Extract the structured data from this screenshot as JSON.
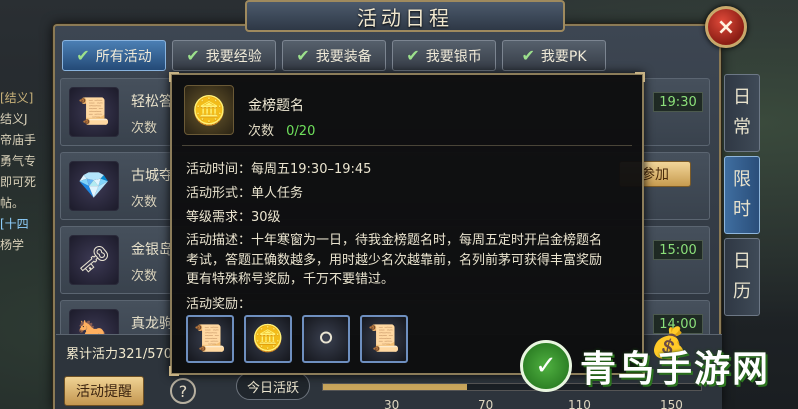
{
  "window": {
    "title": "活动日程"
  },
  "tabs": [
    {
      "label": "所有活动",
      "active": true
    },
    {
      "label": "我要经验",
      "active": false
    },
    {
      "label": "我要装备",
      "active": false
    },
    {
      "label": "我要银币",
      "active": false
    },
    {
      "label": "我要PK",
      "active": false
    }
  ],
  "side_tabs": [
    {
      "chars": [
        "日",
        "常"
      ],
      "active": false
    },
    {
      "chars": [
        "限",
        "时"
      ],
      "active": true
    },
    {
      "chars": [
        "日",
        "历"
      ],
      "active": false
    }
  ],
  "chat": {
    "lines": [
      "[结义]",
      "结义J",
      "帝庙手",
      "勇气专",
      "即可死",
      "帖。",
      "[十四",
      "杨学"
    ]
  },
  "activities": [
    {
      "name": "轻松答",
      "count_label": "次数",
      "time": "19:30",
      "icon": "scroll-icon"
    },
    {
      "name": "古城夺",
      "count_label": "次数",
      "join_label": "参加",
      "icon": "gem-icon"
    },
    {
      "name": "金银岛",
      "count_label": "次数",
      "time": "15:00",
      "icon": "key-icon"
    },
    {
      "name": "真龙驹",
      "count_label": "",
      "time": "14:00",
      "icon": "horse-icon"
    }
  ],
  "tooltip": {
    "name": "金榜题名",
    "count_label": "次数",
    "count_value": "0/20",
    "time_label": "活动时间：每周五19:30–19:45",
    "form_label": "活动形式：单人任务",
    "level_label": "等级需求：30级",
    "desc_lines": [
      "活动描述：十年寒窗为一日，待我金榜题名时，每周五定时开启金榜题名",
      "考试，答题正确数越多，用时越少名次越靠前，名列前茅可获得丰富奖励",
      "更有特殊称号奖励，千万不要错过。"
    ],
    "rewards_label": "活动奖励：",
    "rewards": [
      {
        "icon": "scroll-icon"
      },
      {
        "icon": "gold-coins-icon"
      },
      {
        "icon": "silver-coins-icon"
      },
      {
        "icon": "scroll-icon"
      }
    ]
  },
  "footer": {
    "vitality": "累计活力321/570",
    "remind_label": "活动提醒",
    "help_label": "?",
    "today_label": "今日活跃",
    "ticks": [
      "30",
      "70",
      "110",
      "150"
    ],
    "progress_fraction": 0.38
  },
  "watermark": {
    "text": "青鸟手游网"
  },
  "close_label": "×"
}
